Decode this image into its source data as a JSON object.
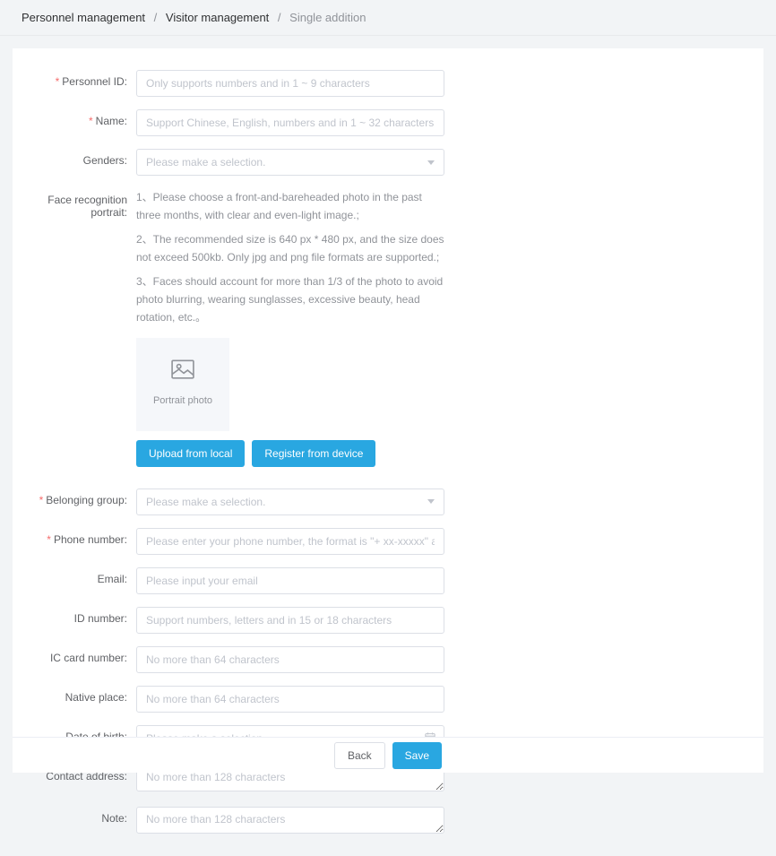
{
  "breadcrumb": {
    "level1": "Personnel management",
    "level2": "Visitor management",
    "level3": "Single addition"
  },
  "labels": {
    "personnel_id": "Personnel ID:",
    "name": "Name:",
    "genders": "Genders:",
    "face_portrait": "Face recognition portrait:",
    "belonging_group": "Belonging group:",
    "phone_number": "Phone number:",
    "email": "Email:",
    "id_number": "ID number:",
    "ic_card_number": "IC card number:",
    "native_place": "Native place:",
    "date_of_birth": "Date of birth:",
    "contact_address": "Contact address:",
    "note": "Note:"
  },
  "placeholders": {
    "personnel_id": "Only supports numbers and in 1 ~ 9 characters",
    "name": "Support Chinese, English, numbers and in 1 ~ 32 characters",
    "genders": "Please make a selection.",
    "belonging_group": "Please make a selection.",
    "phone_number": "Please enter your phone number, the format is \"+ xx-xxxxx\" abroad.",
    "email": "Please input your email",
    "id_number": "Support numbers, letters and in 15 or 18 characters",
    "ic_card_number": "No more than 64 characters",
    "native_place": "No more than 64 characters",
    "date_of_birth": "Please make a selection.",
    "contact_address": "No more than 128 characters",
    "note": "No more than 128 characters"
  },
  "portrait_help": {
    "line1": "1、Please choose a front-and-bareheaded photo in the past three months, with clear and even-light image.;",
    "line2": "2、The recommended size is 640 px * 480 px, and the size does not exceed 500kb. Only jpg and png file formats are supported.;",
    "line3": "3、Faces should account for more than 1/3 of the photo to avoid photo blurring, wearing sunglasses, excessive beauty, head rotation, etc.。",
    "photo_caption": "Portrait photo"
  },
  "buttons": {
    "upload_local": "Upload from local",
    "register_device": "Register from device",
    "back": "Back",
    "save": "Save"
  }
}
